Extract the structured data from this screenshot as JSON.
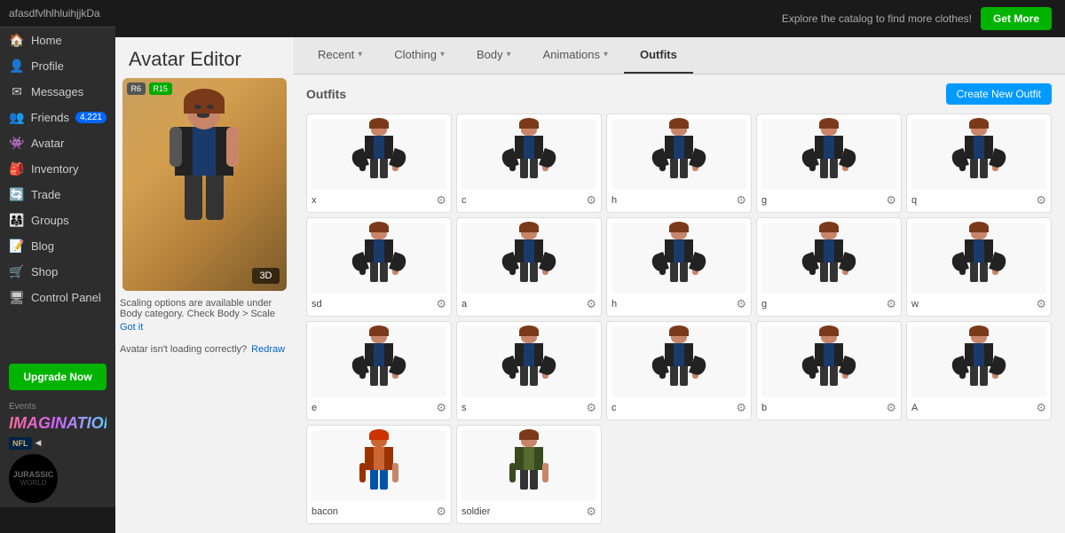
{
  "app": {
    "title": "Avatar Editor"
  },
  "sidebar": {
    "username": "afasdfvlhlhluihjjkDa",
    "nav_items": [
      {
        "id": "home",
        "label": "Home",
        "icon": "🏠"
      },
      {
        "id": "profile",
        "label": "Profile",
        "icon": "👤"
      },
      {
        "id": "messages",
        "label": "Messages",
        "icon": "✉"
      },
      {
        "id": "friends",
        "label": "Friends",
        "icon": "👥",
        "badge": "4,221"
      },
      {
        "id": "avatar",
        "label": "Avatar",
        "icon": "👾"
      },
      {
        "id": "inventory",
        "label": "Inventory",
        "icon": "🎒"
      },
      {
        "id": "trade",
        "label": "Trade",
        "icon": "🔄"
      },
      {
        "id": "groups",
        "label": "Groups",
        "icon": "👨‍👩‍👧"
      },
      {
        "id": "blog",
        "label": "Blog",
        "icon": "📝"
      },
      {
        "id": "shop",
        "label": "Shop",
        "icon": "🛒"
      },
      {
        "id": "control-panel",
        "label": "Control Panel",
        "icon": "🖥"
      }
    ],
    "upgrade_label": "Upgrade Now",
    "events_label": "Events",
    "events_logo": "IMAGINATION"
  },
  "topbar": {
    "catalog_text": "Explore the catalog to find more clothes!",
    "get_more_label": "Get More"
  },
  "tabs": [
    {
      "id": "recent",
      "label": "Recent",
      "has_arrow": true
    },
    {
      "id": "clothing",
      "label": "Clothing",
      "has_arrow": true
    },
    {
      "id": "body",
      "label": "Body",
      "has_arrow": true
    },
    {
      "id": "animations",
      "label": "Animations",
      "has_arrow": true
    },
    {
      "id": "outfits",
      "label": "Outfits",
      "has_arrow": false,
      "active": true
    }
  ],
  "avatar": {
    "r6_label": "R6",
    "r15_label": "R15",
    "three_d_label": "3D",
    "scaling_text": "Scaling options are available under Body category. Check Body > Scale",
    "got_it_label": "Got it",
    "loading_error": "Avatar isn't loading correctly?",
    "redraw_label": "Redraw"
  },
  "outfits": {
    "title": "Outfits",
    "create_label": "Create New Outfit",
    "items": [
      {
        "name": "x",
        "row": 0,
        "col": 0
      },
      {
        "name": "c",
        "row": 0,
        "col": 1
      },
      {
        "name": "h",
        "row": 0,
        "col": 2
      },
      {
        "name": "g",
        "row": 0,
        "col": 3
      },
      {
        "name": "q",
        "row": 0,
        "col": 4
      },
      {
        "name": "sd",
        "row": 1,
        "col": 0
      },
      {
        "name": "a",
        "row": 1,
        "col": 1
      },
      {
        "name": "h",
        "row": 1,
        "col": 2
      },
      {
        "name": "g",
        "row": 1,
        "col": 3
      },
      {
        "name": "w",
        "row": 1,
        "col": 4
      },
      {
        "name": "e",
        "row": 2,
        "col": 0
      },
      {
        "name": "s",
        "row": 2,
        "col": 1
      },
      {
        "name": "c",
        "row": 2,
        "col": 2
      },
      {
        "name": "b",
        "row": 2,
        "col": 3
      },
      {
        "name": "A",
        "row": 2,
        "col": 4
      },
      {
        "name": "bacon",
        "row": 3,
        "col": 0
      },
      {
        "name": "soldier",
        "row": 3,
        "col": 1
      }
    ]
  }
}
